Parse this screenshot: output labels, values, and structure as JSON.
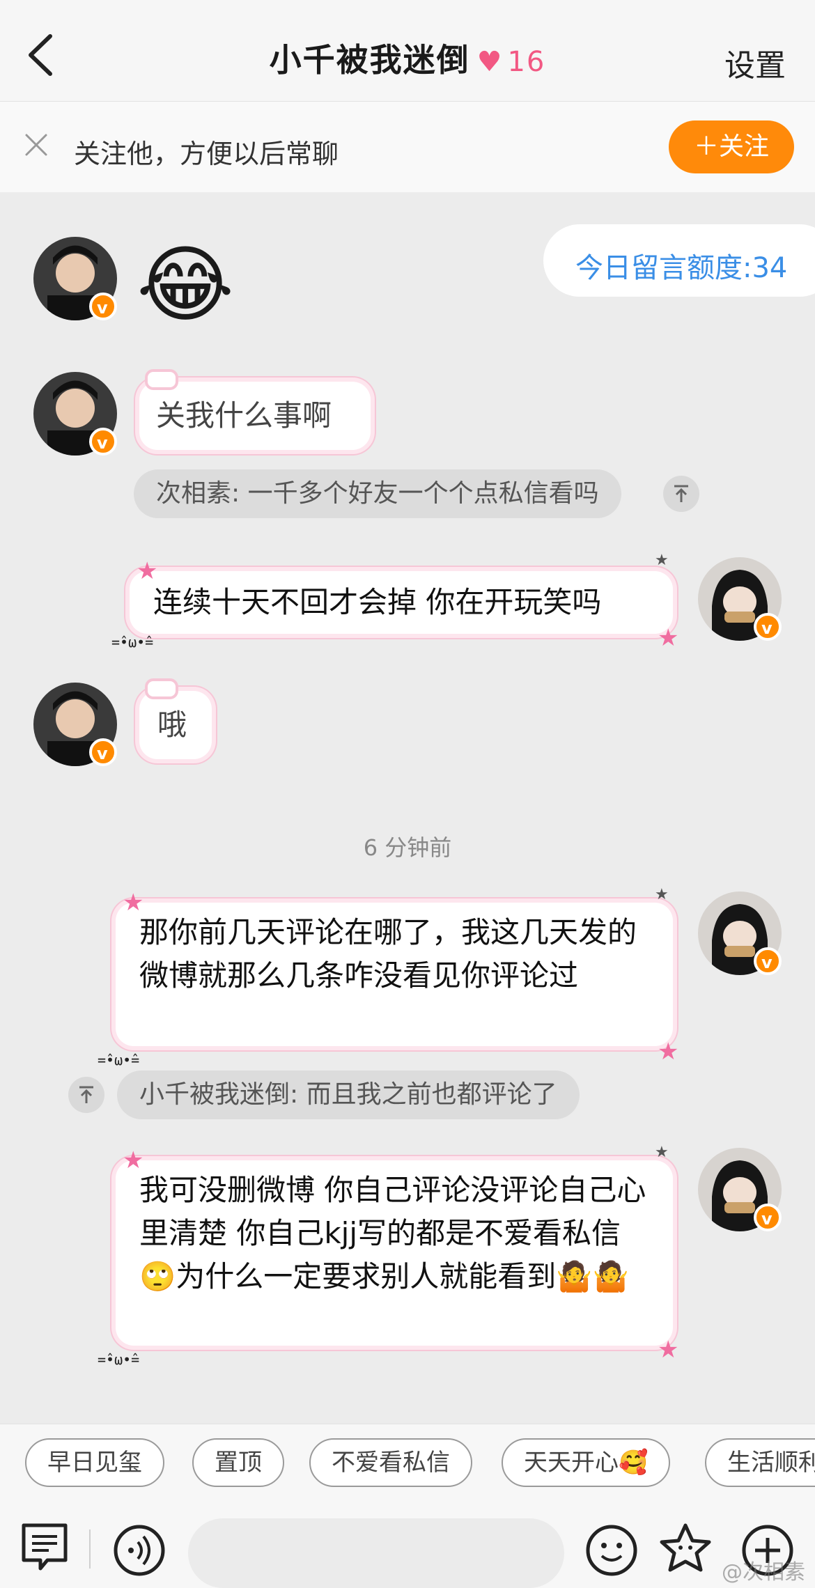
{
  "header": {
    "title": "小千被我迷倒",
    "heart_icon": "heart-icon",
    "heart_count": "16",
    "settings_label": "设置",
    "accent_color": "#f25883"
  },
  "follow_bar": {
    "text": "关注他，方便以后常聊",
    "button_label": "＋关注",
    "button_color": "#ff8a0a"
  },
  "quota": {
    "text": "今日留言额度:34"
  },
  "messages": [
    {
      "side": "left",
      "type": "emoji",
      "content": "😂"
    },
    {
      "side": "left",
      "type": "text",
      "content": "关我什么事啊",
      "quote": "次相素: 一千多个好友一个个点私信看吗"
    },
    {
      "side": "right",
      "type": "text",
      "content": "连续十天不回才会掉 你在开玩笑吗"
    },
    {
      "side": "left",
      "type": "text",
      "content": "哦"
    },
    {
      "side": "right",
      "type": "text",
      "content": "那你前几天评论在哪了，我这几天发的微博就那么几条咋没看见你评论过",
      "quote": "小千被我迷倒: 而且我之前也都评论了"
    },
    {
      "side": "right",
      "type": "text",
      "content": "我可没删微博 你自己评论没评论自己心里清楚 你自己kjj写的都是不爱看私信🙄为什么一定要求别人就能看到🤷🤷"
    }
  ],
  "timestamp": "6 分钟前",
  "kaomoji": "=̂•ω•̂=",
  "quick_replies": [
    "早日见玺",
    "置顶",
    "不爱看私信",
    "天天开心🥰",
    "生活顺利"
  ],
  "input": {
    "placeholder": ""
  },
  "watermark": "@次相素"
}
